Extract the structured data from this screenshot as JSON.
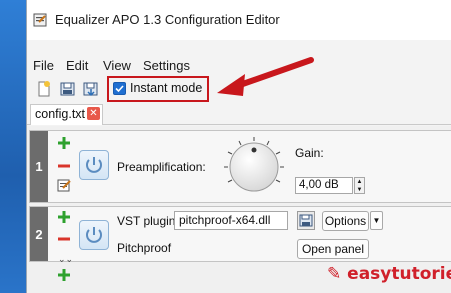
{
  "window": {
    "title": "Equalizer APO 1.3 Configuration Editor"
  },
  "menu": {
    "items": [
      "File",
      "Edit",
      "View",
      "Settings"
    ]
  },
  "toolbar": {
    "instant_mode_label": "Instant mode",
    "instant_mode_checked": true
  },
  "tabs": [
    {
      "label": "config.txt",
      "close": "✕"
    }
  ],
  "filters": [
    {
      "index": "1",
      "label": "Preamplification:",
      "gain_label": "Gain:",
      "gain_value": "4,00 dB"
    },
    {
      "index": "2",
      "vst_label": "VST plugin:",
      "vst_value": "pitchproof-x64.dll",
      "name": "Pitchproof",
      "options_label": "Options",
      "open_panel_label": "Open panel"
    }
  ],
  "watermark": {
    "text": "easytutoriel"
  },
  "colors": {
    "highlight": "#c8171c",
    "accent": "#1f6fd1",
    "add": "#2ea12e",
    "remove": "#d9352b"
  },
  "icons": [
    "app-icon",
    "new-file-icon",
    "open-icon",
    "save-icon",
    "power-icon",
    "edit-icon",
    "plus-icon",
    "minus-icon",
    "expand-icon"
  ]
}
